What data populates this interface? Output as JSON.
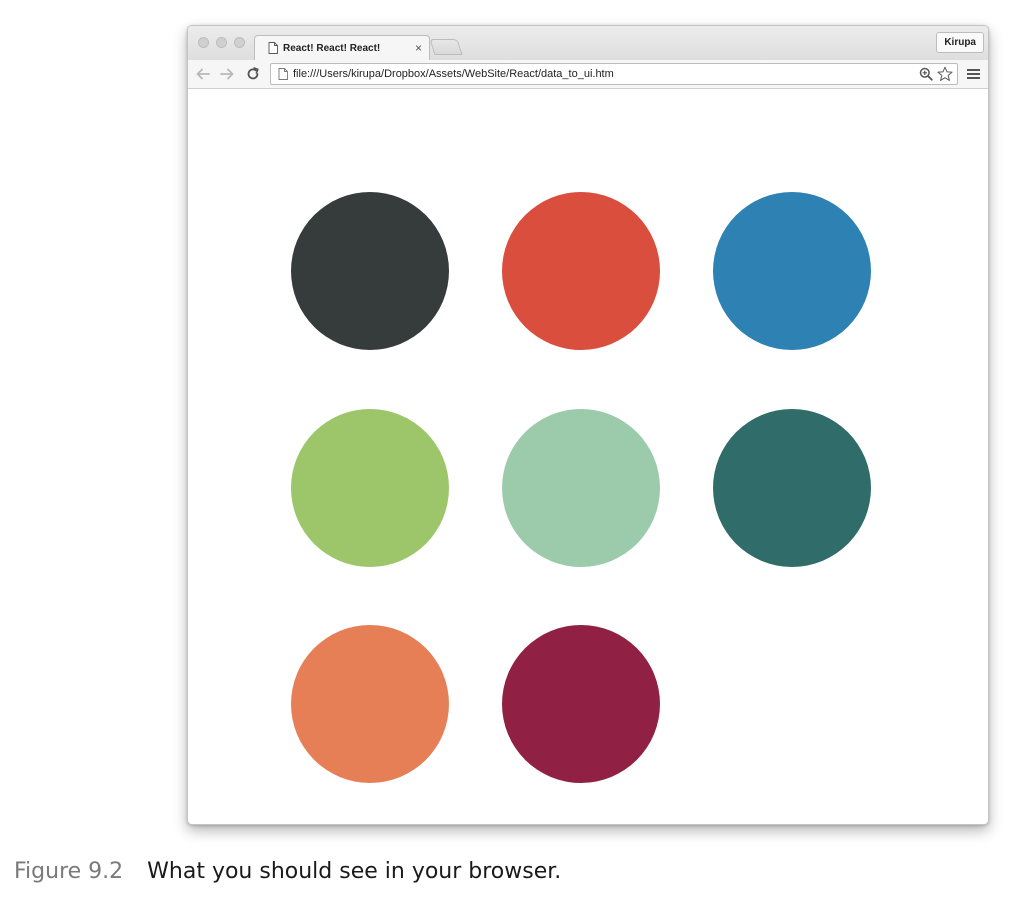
{
  "browser": {
    "tab": {
      "title": "React! React! React!",
      "close_glyph": "×"
    },
    "profile_button_label": "Kirupa",
    "address": {
      "url": "file:///Users/kirupa/Dropbox/Assets/WebSite/React/data_to_ui.htm"
    },
    "icons": {
      "back": "back-arrow-icon",
      "forward": "forward-arrow-icon",
      "reload": "reload-icon",
      "page": "page-icon",
      "zoom": "zoom-icon",
      "bookmark": "star-icon",
      "menu": "hamburger-menu-icon"
    }
  },
  "page": {
    "circles": [
      {
        "color": "#363B3C"
      },
      {
        "color": "#D94E3C"
      },
      {
        "color": "#2D82B3"
      },
      {
        "color": "#9DC66A"
      },
      {
        "color": "#9CCBAB"
      },
      {
        "color": "#306C69"
      },
      {
        "color": "#E67F55"
      },
      {
        "color": "#912045"
      }
    ]
  },
  "caption": {
    "label": "Figure 9.2",
    "text": "What you should see in your browser."
  }
}
